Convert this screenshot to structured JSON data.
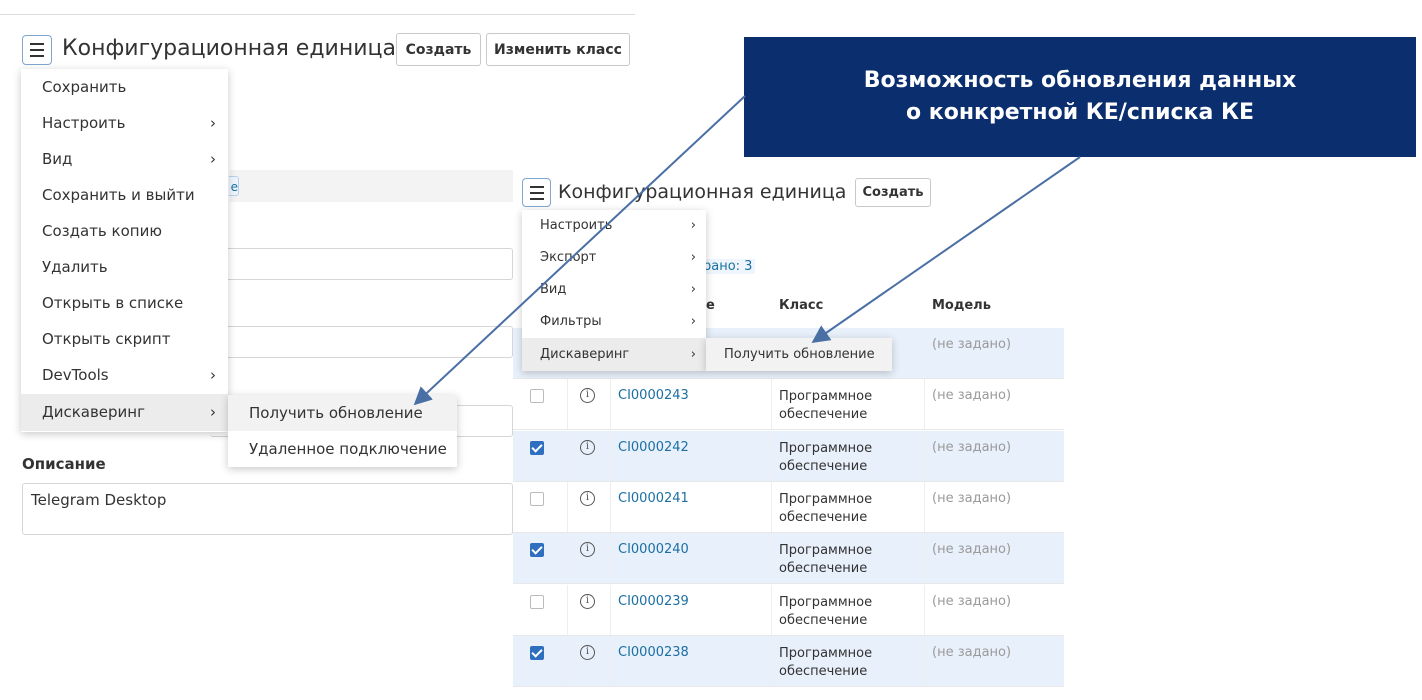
{
  "left_panel": {
    "title": "Конфигурационная единица",
    "create_button": "Создать",
    "change_class_button": "Изменить класс",
    "menu_items": [
      "Сохранить",
      "Настроить",
      "Вид",
      "Сохранить и выйти",
      "Создать копию",
      "Удалить",
      "Открыть в списке",
      "Открыть скрипт",
      "DevTools",
      "Дискаверинг"
    ],
    "chevron": "›",
    "submenu_items": [
      "Получить обновление",
      "Удаленное подключение"
    ],
    "tag_fragment": "e",
    "description_label": "Описание",
    "description_value": "Telegram Desktop"
  },
  "callout": {
    "line1": "Возможность обновления данных",
    "line2": "о конкретной КЕ/списка КЕ",
    "color": "#0b2e6f"
  },
  "right_panel": {
    "title": "Конфигурационная единица",
    "create_button": "Создать",
    "menu_items": [
      "Настроить",
      "Экспорт",
      "Вид",
      "Фильтры",
      "Дискаверинг"
    ],
    "submenu_item": "Получить обновление",
    "selected_count_fragment": "рано: 3",
    "col_name_fragment": "е",
    "col_class": "Класс",
    "col_model": "Модель",
    "first_row_model": "(не задано)",
    "rows": [
      {
        "code": "CI0000243",
        "class": "Программное обеспечение",
        "model": "(не задано)",
        "checked": false
      },
      {
        "code": "CI0000242",
        "class": "Программное обеспечение",
        "model": "(не задано)",
        "checked": true
      },
      {
        "code": "CI0000241",
        "class": "Программное обеспечение",
        "model": "(не задано)",
        "checked": false
      },
      {
        "code": "CI0000240",
        "class": "Программное обеспечение",
        "model": "(не задано)",
        "checked": true
      },
      {
        "code": "CI0000239",
        "class": "Программное обеспечение",
        "model": "(не задано)",
        "checked": false
      },
      {
        "code": "CI0000238",
        "class": "Программное обеспечение",
        "model": "(не задано)",
        "checked": true
      }
    ]
  },
  "accent_color": "#2f6fc0",
  "link_color": "#1b6fa3",
  "icons": {
    "menu": "hamburger-icon",
    "info": "info-icon",
    "checkbox": "checkbox"
  }
}
